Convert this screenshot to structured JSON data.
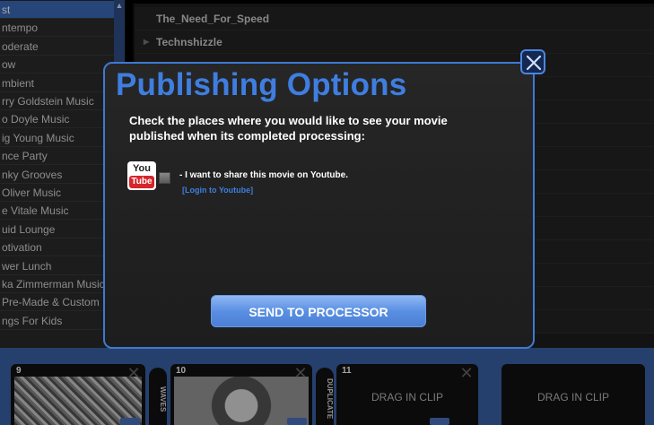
{
  "left_list": {
    "items": [
      {
        "label": "st",
        "selected": true
      },
      {
        "label": "ntempo",
        "selected": false
      },
      {
        "label": "oderate",
        "selected": false
      },
      {
        "label": "ow",
        "selected": false
      },
      {
        "label": "mbient",
        "selected": false
      },
      {
        "label": "rry Goldstein Music",
        "selected": false
      },
      {
        "label": "o Doyle Music",
        "selected": false
      },
      {
        "label": "ig Young Music",
        "selected": false
      },
      {
        "label": "nce Party",
        "selected": false
      },
      {
        "label": "nky Grooves",
        "selected": false
      },
      {
        "label": "Oliver Music",
        "selected": false
      },
      {
        "label": "e Vitale Music",
        "selected": false
      },
      {
        "label": "uid Lounge",
        "selected": false
      },
      {
        "label": "otivation",
        "selected": false
      },
      {
        "label": "wer Lunch",
        "selected": false
      },
      {
        "label": "ka Zimmerman Music",
        "selected": false
      },
      {
        "label": "Pre-Made & Custom",
        "selected": false
      },
      {
        "label": "ngs For Kids",
        "selected": false
      }
    ]
  },
  "right_list": {
    "items": [
      {
        "label": "The_Need_For_Speed"
      },
      {
        "label": "Technshizzle"
      },
      {
        "label": ""
      },
      {
        "label": ""
      },
      {
        "label": ""
      },
      {
        "label": ""
      },
      {
        "label": ""
      },
      {
        "label": ""
      },
      {
        "label": ""
      },
      {
        "label": ""
      },
      {
        "label": ""
      },
      {
        "label": ""
      },
      {
        "label": ""
      },
      {
        "label": ""
      }
    ]
  },
  "timeline": {
    "clips": [
      {
        "number": "9",
        "content": "photo"
      },
      {
        "number": "10",
        "content": "face"
      },
      {
        "number": "11",
        "drag_label": "DRAG IN CLIP"
      },
      {
        "number": "",
        "drag_label": "DRAG IN CLIP"
      }
    ],
    "transitions": [
      "WAVES",
      "DUPLICATE"
    ]
  },
  "modal": {
    "title": "Publishing Options",
    "description": "Check the places where you would like to see your movie published when its completed processing:",
    "youtube": {
      "logo_top": "You",
      "logo_bottom": "Tube",
      "share_text": "- I want to share this movie on Youtube.",
      "login_link": "[Login to Youtube]"
    },
    "send_button": "SEND TO PROCESSOR"
  },
  "colors": {
    "accent": "#3f7ee0",
    "timeline_bg": "#3b63a8",
    "youtube_red": "#d6252b"
  }
}
